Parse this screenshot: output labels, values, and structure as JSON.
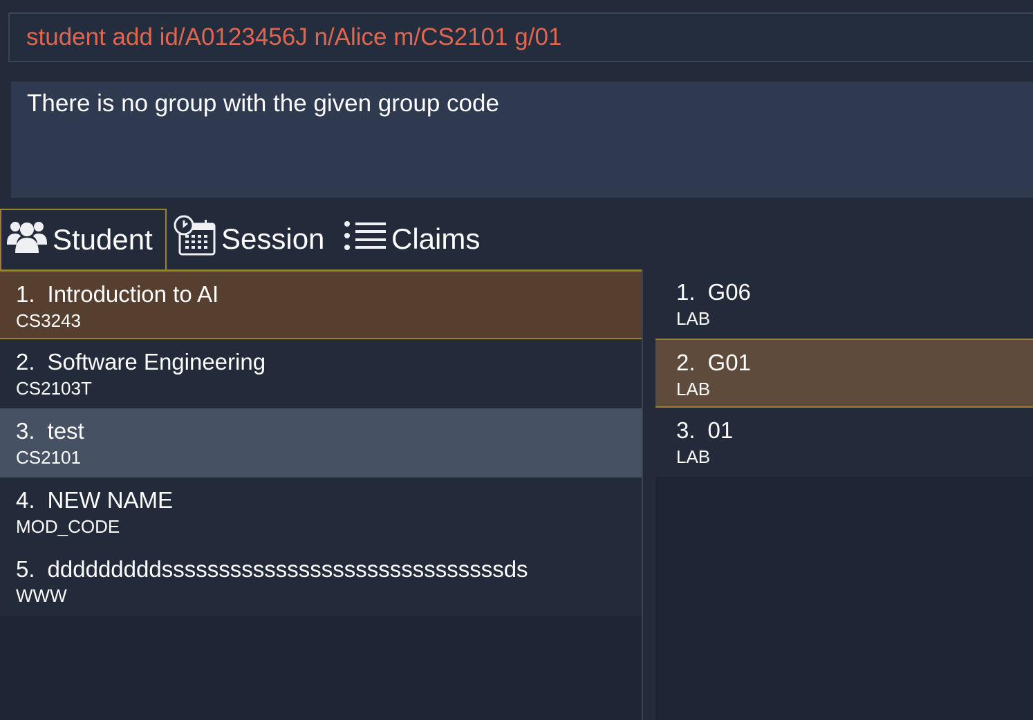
{
  "command": {
    "value": "student add id/A0123456J n/Alice m/CS2101 g/01"
  },
  "result": {
    "message": "There is no group with the given group code"
  },
  "tabs": [
    {
      "label": "Student",
      "icon": "students-icon",
      "selected": true
    },
    {
      "label": "Session",
      "icon": "calendar-clock-icon",
      "selected": false
    },
    {
      "label": "Claims",
      "icon": "list-icon",
      "selected": false
    }
  ],
  "modules": [
    {
      "index": "1.",
      "name": "Introduction to AI",
      "code": "CS3243"
    },
    {
      "index": "2.",
      "name": "Software Engineering",
      "code": "CS2103T"
    },
    {
      "index": "3.",
      "name": "test",
      "code": "CS2101"
    },
    {
      "index": "4.",
      "name": "NEW NAME",
      "code": "MOD_CODE"
    },
    {
      "index": "5.",
      "name": "dddddddddssssssssssssssssssssssssssssssds",
      "code": "WWW"
    }
  ],
  "groups": [
    {
      "index": "1.",
      "name": "G06",
      "type": "LAB"
    },
    {
      "index": "2.",
      "name": "G01",
      "type": "LAB"
    },
    {
      "index": "3.",
      "name": "01",
      "type": "LAB"
    }
  ],
  "colors": {
    "background": "#232b3b",
    "command_text": "#e0664f",
    "selected_row": "#573f30",
    "selected_border": "#9b7e3a",
    "hover_row": "#465163"
  }
}
